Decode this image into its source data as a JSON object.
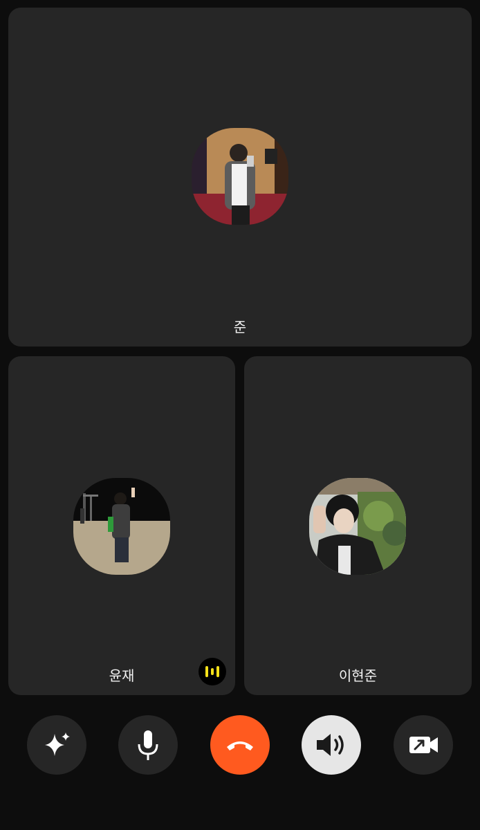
{
  "participants": [
    {
      "name": "준",
      "avatar": "mirror-selfie-photo"
    },
    {
      "name": "윤재",
      "avatar": "beach-night-photo",
      "speaking": true
    },
    {
      "name": "이현준",
      "avatar": "portrait-plants-photo"
    }
  ],
  "controls": {
    "effects": {
      "icon": "sparkle-icon"
    },
    "mic": {
      "icon": "microphone-icon"
    },
    "end_call": {
      "icon": "phone-hangup-icon",
      "color": "#ff5a1f"
    },
    "speaker": {
      "icon": "speaker-icon",
      "active": true
    },
    "video": {
      "icon": "video-camera-icon"
    }
  },
  "colors": {
    "background": "#0d0d0d",
    "tile": "#262626",
    "speaking_indicator": "#f5e11a"
  }
}
